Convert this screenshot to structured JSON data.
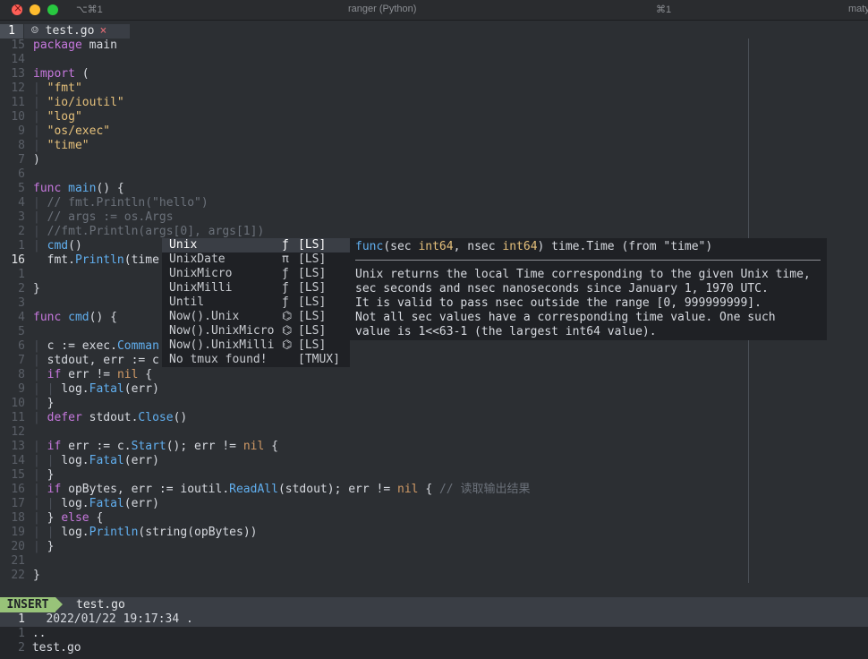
{
  "window": {
    "title": "ranger (Python)",
    "left_shortcut": "⌥⌘1",
    "right_shortcut": "⌘1",
    "user": "maty"
  },
  "tabline": {
    "number": "1",
    "tab_label": "test.go",
    "modified_mark": "×",
    "file_icon": "gopher-icon"
  },
  "editor": {
    "lines": [
      {
        "num": "15",
        "segments": [
          {
            "t": "package ",
            "c": "kw"
          },
          {
            "t": "main",
            "c": ""
          }
        ]
      },
      {
        "num": "14",
        "segments": []
      },
      {
        "num": "13",
        "segments": [
          {
            "t": "import ",
            "c": "kw"
          },
          {
            "t": "(",
            "c": ""
          }
        ]
      },
      {
        "num": "12",
        "segments": [
          {
            "t": "| ",
            "c": "gd"
          },
          {
            "t": "\"fmt\"",
            "c": "str"
          }
        ]
      },
      {
        "num": "11",
        "segments": [
          {
            "t": "| ",
            "c": "gd"
          },
          {
            "t": "\"io/ioutil\"",
            "c": "str"
          }
        ]
      },
      {
        "num": "10",
        "segments": [
          {
            "t": "| ",
            "c": "gd"
          },
          {
            "t": "\"log\"",
            "c": "str"
          }
        ]
      },
      {
        "num": "9",
        "segments": [
          {
            "t": "| ",
            "c": "gd"
          },
          {
            "t": "\"os/exec\"",
            "c": "str"
          }
        ]
      },
      {
        "num": "8",
        "segments": [
          {
            "t": "| ",
            "c": "gd"
          },
          {
            "t": "\"time\"",
            "c": "str"
          }
        ]
      },
      {
        "num": "7",
        "segments": [
          {
            "t": ")",
            "c": ""
          }
        ]
      },
      {
        "num": "6",
        "segments": []
      },
      {
        "num": "5",
        "segments": [
          {
            "t": "func ",
            "c": "kw"
          },
          {
            "t": "main",
            "c": "fn"
          },
          {
            "t": "() {",
            "c": ""
          }
        ]
      },
      {
        "num": "4",
        "segments": [
          {
            "t": "| ",
            "c": "gd"
          },
          {
            "t": "// fmt.Println(\"hello\")",
            "c": "com"
          }
        ]
      },
      {
        "num": "3",
        "segments": [
          {
            "t": "| ",
            "c": "gd"
          },
          {
            "t": "// args := os.Args",
            "c": "com"
          }
        ]
      },
      {
        "num": "2",
        "segments": [
          {
            "t": "| ",
            "c": "gd"
          },
          {
            "t": "//fmt.Println(args[0], args[1])",
            "c": "com"
          }
        ]
      },
      {
        "num": "1",
        "segments": [
          {
            "t": "| ",
            "c": "gd"
          },
          {
            "t": "cmd",
            "c": "fn"
          },
          {
            "t": "()",
            "c": ""
          }
        ]
      },
      {
        "num": "16",
        "current": true,
        "segments": [
          {
            "t": "  fmt.",
            "c": ""
          },
          {
            "t": "Println",
            "c": "fn"
          },
          {
            "t": "(time",
            "c": ""
          }
        ]
      },
      {
        "num": "1",
        "segments": []
      },
      {
        "num": "2",
        "segments": [
          {
            "t": "}",
            "c": ""
          }
        ]
      },
      {
        "num": "3",
        "segments": []
      },
      {
        "num": "4",
        "segments": [
          {
            "t": "func ",
            "c": "kw"
          },
          {
            "t": "cmd",
            "c": "fn"
          },
          {
            "t": "() {",
            "c": ""
          }
        ]
      },
      {
        "num": "5",
        "segments": []
      },
      {
        "num": "6",
        "segments": [
          {
            "t": "| ",
            "c": "gd"
          },
          {
            "t": "c := exec.",
            "c": ""
          },
          {
            "t": "Comman",
            "c": "fn"
          }
        ]
      },
      {
        "num": "7",
        "segments": [
          {
            "t": "| ",
            "c": "gd"
          },
          {
            "t": "stdout, err := c",
            "c": ""
          }
        ]
      },
      {
        "num": "8",
        "segments": [
          {
            "t": "| ",
            "c": "gd"
          },
          {
            "t": "if ",
            "c": "kw"
          },
          {
            "t": "err != ",
            "c": ""
          },
          {
            "t": "nil",
            "c": "nil"
          },
          {
            "t": " {",
            "c": ""
          }
        ]
      },
      {
        "num": "9",
        "segments": [
          {
            "t": "| | ",
            "c": "gd"
          },
          {
            "t": "log.",
            "c": ""
          },
          {
            "t": "Fatal",
            "c": "fn"
          },
          {
            "t": "(err)",
            "c": ""
          }
        ]
      },
      {
        "num": "10",
        "segments": [
          {
            "t": "| ",
            "c": "gd"
          },
          {
            "t": "}",
            "c": ""
          }
        ]
      },
      {
        "num": "11",
        "segments": [
          {
            "t": "| ",
            "c": "gd"
          },
          {
            "t": "defer ",
            "c": "kw"
          },
          {
            "t": "stdout.",
            "c": ""
          },
          {
            "t": "Close",
            "c": "fn"
          },
          {
            "t": "()",
            "c": ""
          }
        ]
      },
      {
        "num": "12",
        "segments": []
      },
      {
        "num": "13",
        "segments": [
          {
            "t": "| ",
            "c": "gd"
          },
          {
            "t": "if ",
            "c": "kw"
          },
          {
            "t": "err := c.",
            "c": ""
          },
          {
            "t": "Start",
            "c": "fn"
          },
          {
            "t": "(); err != ",
            "c": ""
          },
          {
            "t": "nil",
            "c": "nil"
          },
          {
            "t": " {",
            "c": ""
          }
        ]
      },
      {
        "num": "14",
        "segments": [
          {
            "t": "| | ",
            "c": "gd"
          },
          {
            "t": "log.",
            "c": ""
          },
          {
            "t": "Fatal",
            "c": "fn"
          },
          {
            "t": "(err)",
            "c": ""
          }
        ]
      },
      {
        "num": "15",
        "segments": [
          {
            "t": "| ",
            "c": "gd"
          },
          {
            "t": "}",
            "c": ""
          }
        ]
      },
      {
        "num": "16",
        "segments": [
          {
            "t": "| ",
            "c": "gd"
          },
          {
            "t": "if ",
            "c": "kw"
          },
          {
            "t": "opBytes, err := ioutil.",
            "c": ""
          },
          {
            "t": "ReadAll",
            "c": "fn"
          },
          {
            "t": "(stdout); err != ",
            "c": ""
          },
          {
            "t": "nil",
            "c": "nil"
          },
          {
            "t": " { ",
            "c": ""
          },
          {
            "t": "// 读取输出结果",
            "c": "com"
          }
        ]
      },
      {
        "num": "17",
        "segments": [
          {
            "t": "| | ",
            "c": "gd"
          },
          {
            "t": "log.",
            "c": ""
          },
          {
            "t": "Fatal",
            "c": "fn"
          },
          {
            "t": "(err)",
            "c": ""
          }
        ]
      },
      {
        "num": "18",
        "segments": [
          {
            "t": "| ",
            "c": "gd"
          },
          {
            "t": "} ",
            "c": ""
          },
          {
            "t": "else",
            "c": "kw"
          },
          {
            "t": " {",
            "c": ""
          }
        ]
      },
      {
        "num": "19",
        "segments": [
          {
            "t": "| | ",
            "c": "gd"
          },
          {
            "t": "log.",
            "c": ""
          },
          {
            "t": "Println",
            "c": "fn"
          },
          {
            "t": "(string(opBytes))",
            "c": ""
          }
        ]
      },
      {
        "num": "20",
        "segments": [
          {
            "t": "| ",
            "c": "gd"
          },
          {
            "t": "}",
            "c": ""
          }
        ]
      },
      {
        "num": "21",
        "segments": []
      },
      {
        "num": "22",
        "segments": [
          {
            "t": "}",
            "c": ""
          }
        ]
      }
    ]
  },
  "completion": {
    "items": [
      {
        "word": "Unix",
        "kind": "ƒ",
        "source": "[LS]",
        "selected": true
      },
      {
        "word": "UnixDate",
        "kind": "π",
        "source": "[LS]"
      },
      {
        "word": "UnixMicro",
        "kind": "ƒ",
        "source": "[LS]"
      },
      {
        "word": "UnixMilli",
        "kind": "ƒ",
        "source": "[LS]"
      },
      {
        "word": "Until",
        "kind": "ƒ",
        "source": "[LS]"
      },
      {
        "word": "Now().Unix",
        "kind": "⌬",
        "source": "[LS]"
      },
      {
        "word": "Now().UnixMicro",
        "kind": "⌬",
        "source": "[LS]"
      },
      {
        "word": "Now().UnixMilli",
        "kind": "⌬",
        "source": "[LS]"
      },
      {
        "word": "No tmux found!",
        "kind": "",
        "source": "[TMUX]"
      }
    ]
  },
  "doc": {
    "signature": [
      {
        "t": "func",
        "c": "fn"
      },
      {
        "t": "(sec ",
        "c": ""
      },
      {
        "t": "int64",
        "c": "type"
      },
      {
        "t": ", nsec ",
        "c": ""
      },
      {
        "t": "int64",
        "c": "type"
      },
      {
        "t": ") time.Time (from \"time\")",
        "c": ""
      }
    ],
    "body": [
      "Unix returns the local Time corresponding to the given Unix time,",
      "sec seconds and nsec nanoseconds since January 1, 1970 UTC.",
      "It is valid to pass nsec outside the range [0, 999999999].",
      "Not all sec values have a corresponding time value. One such",
      "value is 1<<63-1 (the largest int64 value)."
    ]
  },
  "statusline": {
    "mode": "INSERT",
    "file": "test.go"
  },
  "terminal": {
    "lines": [
      {
        "num": "1",
        "text": "   2022/01/22 19:17:34 .",
        "highlight": true
      },
      {
        "num": "1",
        "text": " ..",
        "highlight": false
      },
      {
        "num": "2",
        "text": " test.go",
        "highlight": false
      }
    ]
  },
  "colors": {
    "mode_bg": "#98c379",
    "keyword": "#c678dd",
    "function": "#61afef",
    "string": "#e5c07b",
    "comment": "#6b717a"
  }
}
